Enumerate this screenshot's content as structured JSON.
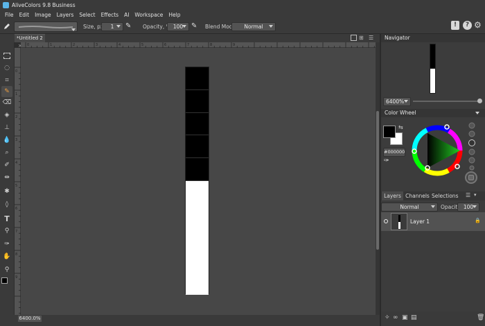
{
  "app": {
    "title": "AliveColors 9.8 Business"
  },
  "menu": [
    "File",
    "Edit",
    "Image",
    "Layers",
    "Select",
    "Effects",
    "AI",
    "Workspace",
    "Help"
  ],
  "options": {
    "size_label": "Size, px",
    "size_value": "1",
    "opacity_label": "Opacity, %",
    "opacity_value": "100",
    "blend_label": "Blend Mode:",
    "blend_value": "Normal"
  },
  "document": {
    "tab_title": "*Untitled 2",
    "tab_close": "×",
    "zoom_status": "6400.0%",
    "ruler_h": [
      "0",
      "1",
      "2",
      "3",
      "4",
      "5",
      "6",
      "7",
      "8",
      "9"
    ],
    "ruler_v": [
      "0",
      "1",
      "2",
      "3",
      "4",
      "5",
      "6",
      "7",
      "8",
      "9"
    ],
    "canvas_pixels": [
      "black",
      "black",
      "black",
      "black",
      "black",
      "white",
      "white",
      "white",
      "white",
      "white"
    ]
  },
  "navigator": {
    "title": "Navigator",
    "zoom": "6400%"
  },
  "color_wheel": {
    "title": "Color Wheel",
    "hex": "#000000",
    "fg": "#000000",
    "bg": "#ffffff"
  },
  "layers_panel": {
    "tabs": [
      "Layers",
      "Channels",
      "Selections"
    ],
    "blend": "Normal",
    "opacity_label": "Opacity:",
    "opacity_value": "100",
    "layers": [
      {
        "name": "Layer 1"
      }
    ]
  },
  "colors": {
    "accent": "#5bb5e8",
    "panel_bg": "#3c3c3c",
    "canvas_bg": "#474747"
  }
}
